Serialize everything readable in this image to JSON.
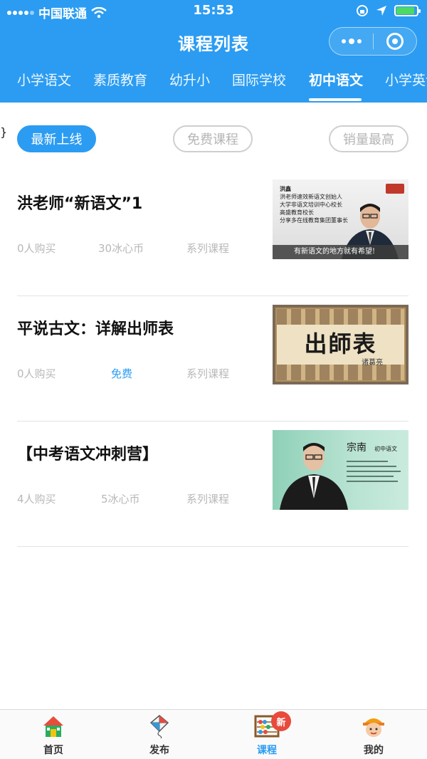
{
  "status_bar": {
    "carrier": "中国联通",
    "time": "15:53"
  },
  "header": {
    "title": "课程列表"
  },
  "tabs": [
    {
      "label": "小学语文"
    },
    {
      "label": "素质教育"
    },
    {
      "label": "幼升小"
    },
    {
      "label": "国际学校"
    },
    {
      "label": "初中语文"
    },
    {
      "label": "小学英语"
    }
  ],
  "active_tab": "初中语文",
  "filters": [
    {
      "label": "最新上线"
    },
    {
      "label": "免费课程"
    },
    {
      "label": "销量最高"
    }
  ],
  "courses": [
    {
      "title": "洪老师“新语文”1",
      "buyers": "0人购买",
      "price": "30冰心币",
      "type": "系列课程",
      "thumb_lines": [
        "洪鑫",
        "洪老师速效新语文创始人",
        "大学非语文培训中心校长",
        "高盛教育校长",
        "分享多在线教育集团董事长"
      ],
      "thumb_caption": "有新语文的地方就有希望!"
    },
    {
      "title": "平说古文：详解出师表",
      "buyers": "0人购买",
      "price": "免费",
      "type": "系列课程",
      "thumb_title": "出師表",
      "thumb_sub": "诸葛亮"
    },
    {
      "title": "【中考语文冲刺营】",
      "buyers": "4人购买",
      "price": "5冰心币",
      "type": "系列课程",
      "thumb_name": "宗南",
      "thumb_role": "初中语文"
    }
  ],
  "tabbar": [
    {
      "label": "首页",
      "icon": "house-icon"
    },
    {
      "label": "发布",
      "icon": "kite-icon"
    },
    {
      "label": "课程",
      "icon": "abacus-icon",
      "badge": "新"
    },
    {
      "label": "我的",
      "icon": "kid-avatar-icon"
    }
  ],
  "colors": {
    "primary": "#2b9cf2",
    "badge": "#e84a3c",
    "battery": "#4cd964"
  }
}
